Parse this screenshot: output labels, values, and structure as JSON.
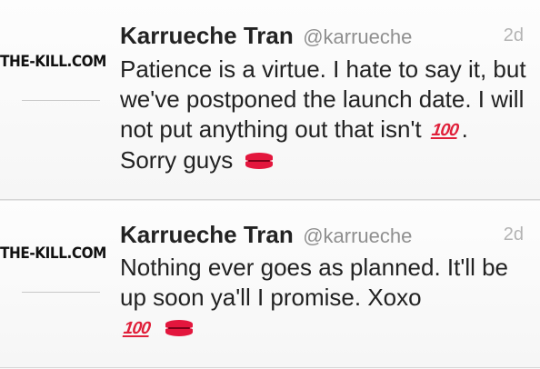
{
  "tweets": [
    {
      "avatar_text": "THE-KILL.COM",
      "name": "Karrueche Tran",
      "handle": "@karrueche",
      "time": "2d",
      "text_main": "Patience is a virtue. I hate to say it, but we've postponed the launch date. I will not put anything out that isn't",
      "text_after": ". Sorry guys",
      "emojis": [
        "hundred-points-icon",
        "kiss-mark-icon"
      ]
    },
    {
      "avatar_text": "THE-KILL.COM",
      "name": "Karrueche Tran",
      "handle": "@karrueche",
      "time": "2d",
      "text_main": "Nothing ever goes as planned. It'll be up soon ya'll I promise. Xoxo",
      "emojis": [
        "hundred-points-icon",
        "kiss-mark-icon"
      ]
    }
  ],
  "emoji_glyphs": {
    "hundred": "100"
  },
  "colors": {
    "emoji_red": "#e0203a",
    "handle_gray": "#8f8f8f",
    "time_gray": "#b3b3b3"
  }
}
